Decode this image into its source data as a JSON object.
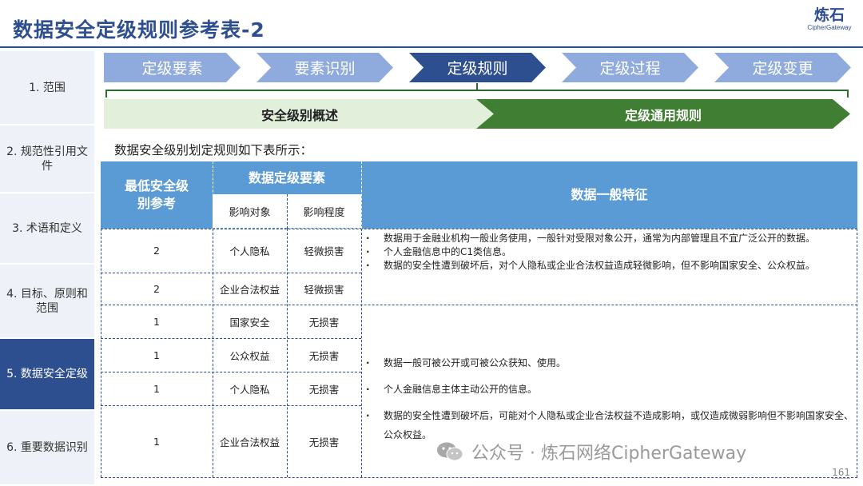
{
  "title": "数据安全定级规则参考表-2",
  "brand": {
    "name": "炼石",
    "tagline": "CipherGateway"
  },
  "sidebar": {
    "items": [
      {
        "label": "1.  范围",
        "active": false
      },
      {
        "label": "2. 规范性引用文件",
        "active": false
      },
      {
        "label": "3. 术语和定义",
        "active": false
      },
      {
        "label": "4.  目标、原则和范围",
        "active": false
      },
      {
        "label": "5. 数据安全定级",
        "active": true
      },
      {
        "label": "6. 重要数据识别",
        "active": false
      }
    ]
  },
  "steps": [
    {
      "label": "定级要素",
      "active": false
    },
    {
      "label": "要素识别",
      "active": false
    },
    {
      "label": "定级规则",
      "active": true
    },
    {
      "label": "定级过程",
      "active": false
    },
    {
      "label": "定级变更",
      "active": false
    }
  ],
  "subtabs": [
    {
      "label": "安全级别概述"
    },
    {
      "label": "定级通用规则"
    }
  ],
  "intro": "数据安全级别划定规则如下表所示：",
  "table": {
    "headers": {
      "min_level": "最低安全级别参考",
      "elements": "数据定级要素",
      "target": "影响对象",
      "degree": "影响程度",
      "features": "数据一般特征"
    },
    "rows": [
      {
        "level": "2",
        "target": "个人隐私",
        "degree": "轻微损害"
      },
      {
        "level": "2",
        "target": "企业合法权益",
        "degree": "轻微损害"
      },
      {
        "level": "1",
        "target": "国家安全",
        "degree": "无损害"
      },
      {
        "level": "1",
        "target": "公众权益",
        "degree": "无损害"
      },
      {
        "level": "1",
        "target": "个人隐私",
        "degree": "无损害"
      },
      {
        "level": "1",
        "target": "企业合法权益",
        "degree": "无损害"
      }
    ],
    "features_group1": [
      "数据用于金融业机构一般业务使用，一般针对受限对象公开，通常为内部管理且不宜广泛公开的数据。",
      "个人金融信息中的C1类信息。",
      "数据的安全性遭到破坏后，对个人隐私或企业合法权益造成轻微影响，但不影响国家安全、公众权益。"
    ],
    "features_group2": [
      "数据一般可被公开或可被公众获知、使用。",
      "个人金融信息主体主动公开的信息。",
      "数据的安全性遭到破坏后，可能对个人隐私或企业合法权益不造成影响，或仅造成微弱影响但不影响国家安全、公众权益。"
    ]
  },
  "watermark": "公众号 · 炼石网络CipherGateway",
  "page_number": "161"
}
